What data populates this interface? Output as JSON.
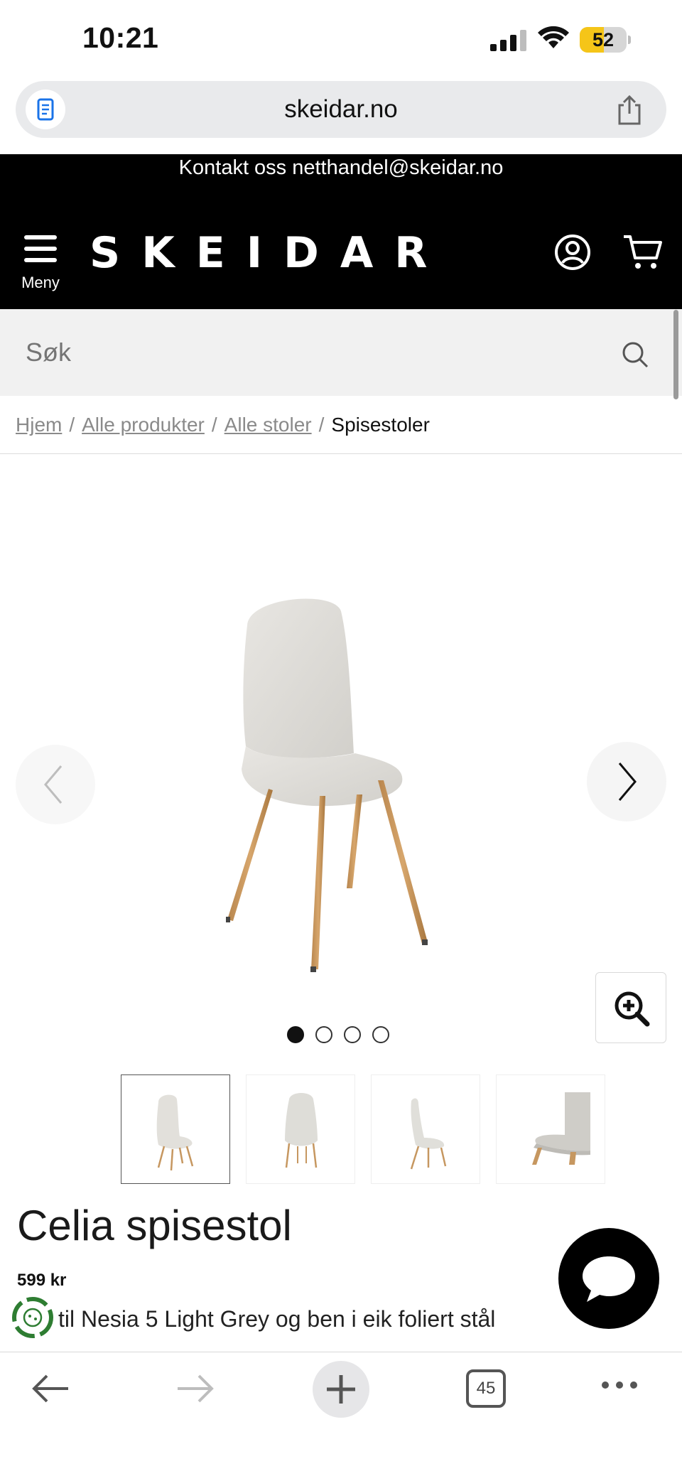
{
  "status_bar": {
    "time": "10:21",
    "battery": "52",
    "battery_level": 0.52
  },
  "browser": {
    "url": "skeidar.no"
  },
  "site": {
    "contact": "Kontakt oss netthandel@skeidar.no",
    "logo": "SKEIDAR",
    "menu_label": "Meny",
    "search_placeholder": "Søk"
  },
  "breadcrumb": {
    "items": [
      "Hjem",
      "Alle produkter",
      "Alle stoler"
    ],
    "separator": "/",
    "current": "Spisestoler"
  },
  "gallery": {
    "image_count": 4,
    "active_index": 0
  },
  "product": {
    "title": "Celia spisestol",
    "price": "599 kr",
    "description": "til Nesia 5 Light Grey og ben i eik foliert stål",
    "description_line2": "... ..."
  },
  "toolbar": {
    "tab_count": "45"
  },
  "colors": {
    "header_bg": "#000000",
    "search_bg": "#f1f1f1",
    "battery": "#f5c518",
    "eco_green": "#2e7d32"
  }
}
